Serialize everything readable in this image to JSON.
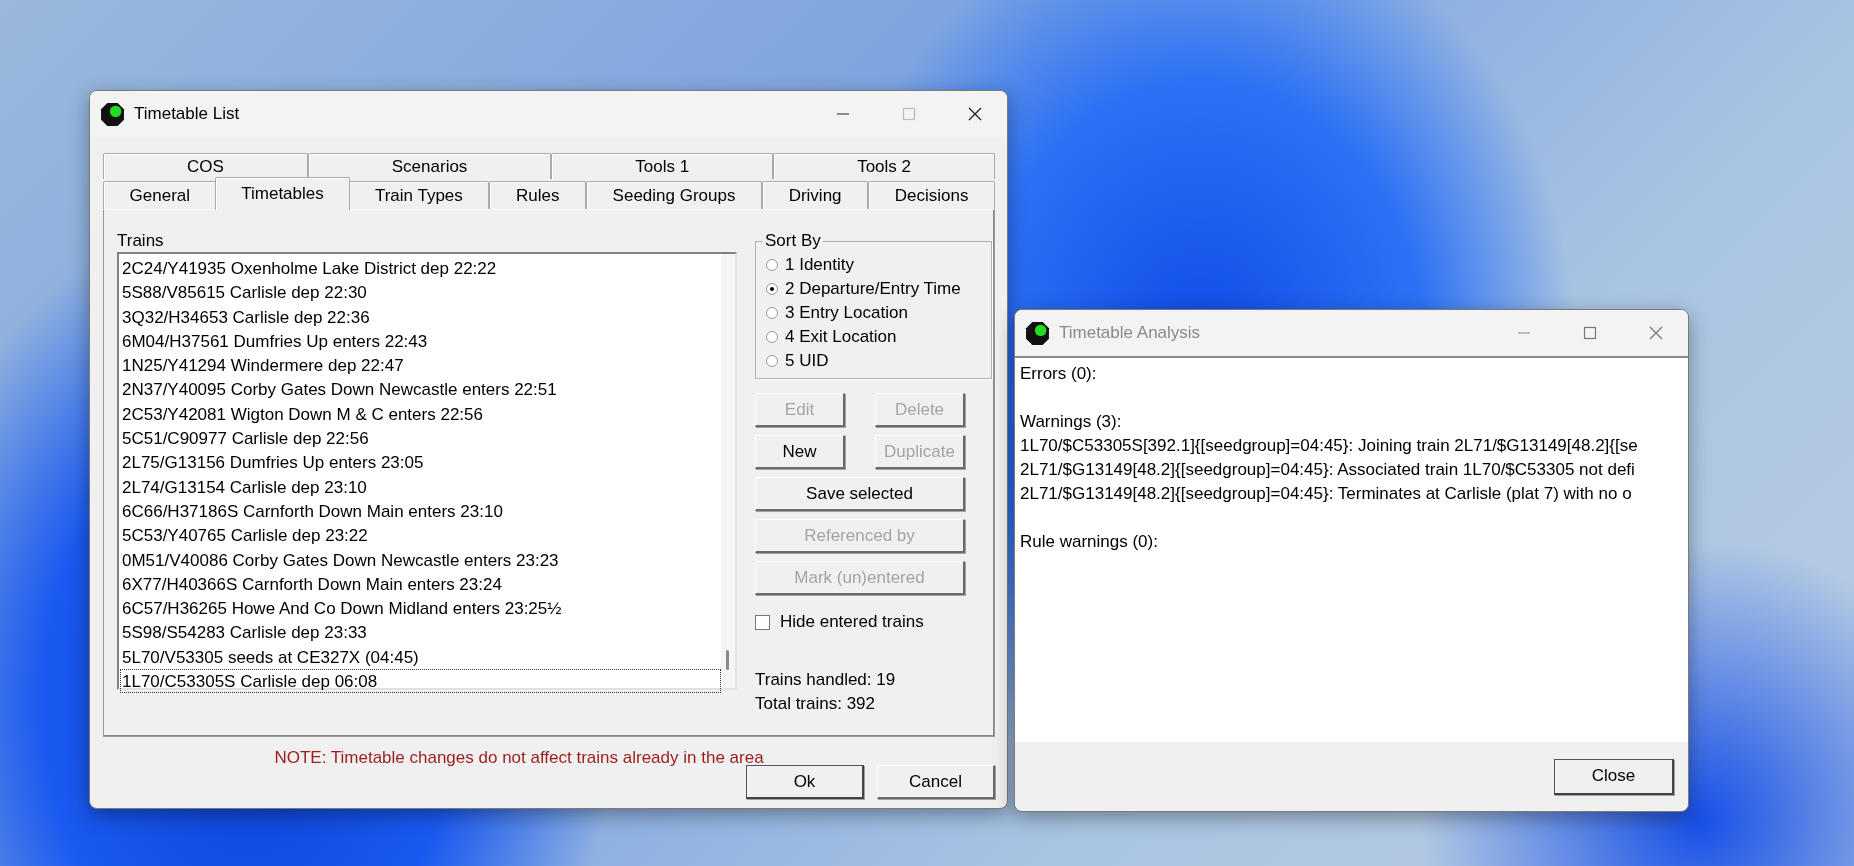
{
  "timetable_window": {
    "title": "Timetable List",
    "tabs_row_1": [
      {
        "label": "COS",
        "selected": false
      },
      {
        "label": "Scenarios",
        "selected": false
      },
      {
        "label": "Tools 1",
        "selected": false
      },
      {
        "label": "Tools 2",
        "selected": false
      }
    ],
    "tabs_row_2": [
      {
        "label": "General",
        "selected": false
      },
      {
        "label": "Timetables",
        "selected": true
      },
      {
        "label": "Train Types",
        "selected": false
      },
      {
        "label": "Rules",
        "selected": false
      },
      {
        "label": "Seeding Groups",
        "selected": false
      },
      {
        "label": "Driving",
        "selected": false
      },
      {
        "label": "Decisions",
        "selected": false
      }
    ],
    "trains_label": "Trains",
    "trains": [
      {
        "text": "2C24/Y41935 Oxenholme Lake District dep 22:22",
        "selected": false
      },
      {
        "text": "5S88/V85615 Carlisle dep 22:30",
        "selected": false
      },
      {
        "text": "3Q32/H34653 Carlisle dep 22:36",
        "selected": false
      },
      {
        "text": "6M04/H37561 Dumfries Up  enters 22:43",
        "selected": false
      },
      {
        "text": "1N25/Y41294 Windermere dep 22:47",
        "selected": false
      },
      {
        "text": "2N37/Y40095 Corby Gates Down Newcastle enters 22:51",
        "selected": false
      },
      {
        "text": "2C53/Y42081 Wigton Down M & C enters 22:56",
        "selected": false
      },
      {
        "text": "5C51/C90977 Carlisle dep 22:56",
        "selected": false
      },
      {
        "text": "2L75/G13156 Dumfries Up  enters 23:05",
        "selected": false
      },
      {
        "text": "2L74/G13154 Carlisle dep 23:10",
        "selected": false
      },
      {
        "text": "6C66/H37186S Carnforth Down Main enters 23:10",
        "selected": false
      },
      {
        "text": "5C53/Y40765 Carlisle dep 23:22",
        "selected": false
      },
      {
        "text": "0M51/V40086 Corby Gates Down Newcastle enters 23:23",
        "selected": false
      },
      {
        "text": "6X77/H40366S Carnforth Down Main enters 23:24",
        "selected": false
      },
      {
        "text": "6C57/H36265 Howe And Co Down Midland enters 23:25½",
        "selected": false
      },
      {
        "text": "5S98/S54283 Carlisle dep 23:33",
        "selected": false
      },
      {
        "text": "5L70/V53305 seeds at CE327X (04:45)",
        "selected": false
      },
      {
        "text": "1L70/C53305S Carlisle dep 06:08",
        "selected": true
      }
    ],
    "sort_by": {
      "title": "Sort By",
      "options": [
        {
          "label": "1 Identity",
          "selected": false
        },
        {
          "label": "2 Departure/Entry Time",
          "selected": true
        },
        {
          "label": "3 Entry Location",
          "selected": false
        },
        {
          "label": "4 Exit Location",
          "selected": false
        },
        {
          "label": "5 UID",
          "selected": false
        }
      ]
    },
    "buttons": [
      {
        "label": "Edit",
        "kind": "half",
        "disabled": true
      },
      {
        "label": "Delete",
        "kind": "half",
        "disabled": true
      },
      {
        "label": "New",
        "kind": "half",
        "disabled": false
      },
      {
        "label": "Duplicate",
        "kind": "half",
        "disabled": true
      },
      {
        "label": "Save selected",
        "kind": "full",
        "disabled": false
      },
      {
        "label": "Referenced by",
        "kind": "full",
        "disabled": true
      },
      {
        "label": "Mark (un)entered",
        "kind": "full",
        "disabled": true
      }
    ],
    "hide_entered": {
      "label": "Hide entered trains",
      "checked": false
    },
    "trains_handled": "Trains handled: 19",
    "total_trains": "Total trains: 392",
    "note": "NOTE: Timetable changes do not affect trains already in the area",
    "footer_buttons": [
      "Ok",
      "Cancel"
    ]
  },
  "analysis_window": {
    "title": "Timetable Analysis",
    "sections": [
      {
        "heading": "Errors (0):"
      },
      {
        "heading": "Warnings (3):",
        "lines": [
          "1L70/$C53305S[392.1]{[seedgroup]=04:45}: Joining train 2L71/$G13149[48.2]{[se",
          "2L71/$G13149[48.2]{[seedgroup]=04:45}: Associated train 1L70/$C53305 not defi",
          "2L71/$G13149[48.2]{[seedgroup]=04:45}: Terminates at Carlisle (plat 7) with no o"
        ]
      },
      {
        "heading": "Rule warnings (0):"
      }
    ],
    "close_button": "Close"
  }
}
